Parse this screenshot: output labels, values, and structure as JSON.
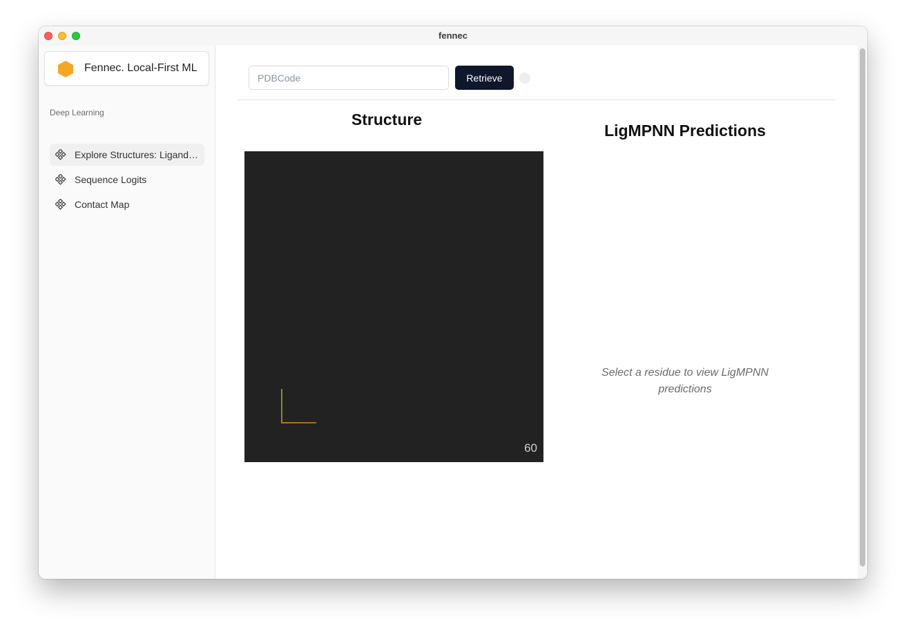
{
  "window": {
    "title": "fennec"
  },
  "sidebar": {
    "brand": {
      "name": "Fennec. Local-First ML",
      "logo_color": "#f5a623"
    },
    "section_label": "Deep Learning",
    "items": [
      {
        "label": "Explore Structures: Ligand…",
        "icon": "diamond-nodes-icon"
      },
      {
        "label": "Sequence Logits",
        "icon": "diamond-nodes-icon"
      },
      {
        "label": "Contact Map",
        "icon": "diamond-nodes-icon"
      }
    ]
  },
  "toolbar": {
    "pdb_placeholder": "PDBCode",
    "pdb_value": "",
    "retrieve_label": "Retrieve",
    "accent": "#0f172a"
  },
  "structure": {
    "title": "Structure",
    "fps": "60",
    "background": "#222222"
  },
  "predictions": {
    "title": "LigMPNN Predictions",
    "empty_text": "Select a residue to view LigMPNN predictions"
  }
}
